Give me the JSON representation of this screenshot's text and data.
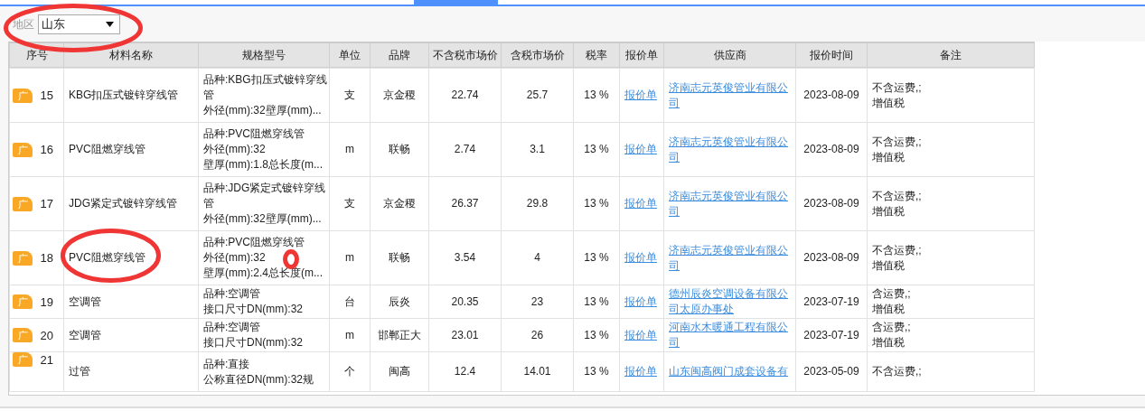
{
  "filter": {
    "label": "地区",
    "value": "山东"
  },
  "table": {
    "columns": [
      "序号",
      "材料名称",
      "规格型号",
      "单位",
      "品牌",
      "不含税市场价",
      "含税市场价",
      "税率",
      "报价单",
      "供应商",
      "报价时间",
      "备注"
    ],
    "rows": [
      {
        "badge": "广",
        "index": "15",
        "name": "KBG扣压式镀锌穿线管",
        "spec": [
          "品种:KBG扣压式镀锌穿线",
          "管",
          "外径(mm):32壁厚(mm)..."
        ],
        "unit": "支",
        "brand": "京金稷",
        "price": "22.74",
        "price_tax": "25.7",
        "tax_rate": "13 %",
        "quote": "报价单",
        "supplier": "济南志元英俊管业有限公司",
        "date": "2023-08-09",
        "remark": [
          "不含运费,;",
          "增值税"
        ]
      },
      {
        "badge": "广",
        "index": "16",
        "name": "PVC阻燃穿线管",
        "spec": [
          "品种:PVC阻燃穿线管",
          "外径(mm):32",
          "壁厚(mm):1.8总长度(m..."
        ],
        "unit": "m",
        "brand": "联畅",
        "price": "2.74",
        "price_tax": "3.1",
        "tax_rate": "13 %",
        "quote": "报价单",
        "supplier": "济南志元英俊管业有限公司",
        "date": "2023-08-09",
        "remark": [
          "不含运费,;",
          "增值税"
        ]
      },
      {
        "badge": "广",
        "index": "17",
        "name": "JDG紧定式镀锌穿线管",
        "spec": [
          "品种:JDG紧定式镀锌穿线",
          "管",
          "外径(mm):32壁厚(mm)..."
        ],
        "unit": "支",
        "brand": "京金稷",
        "price": "26.37",
        "price_tax": "29.8",
        "tax_rate": "13 %",
        "quote": "报价单",
        "supplier": "济南志元英俊管业有限公司",
        "date": "2023-08-09",
        "remark": [
          "不含运费,;",
          "增值税"
        ]
      },
      {
        "badge": "广",
        "index": "18",
        "name": "PVC阻燃穿线管",
        "spec": [
          "品种:PVC阻燃穿线管",
          "外径(mm):32",
          "壁厚(mm):2.4总长度(m..."
        ],
        "unit": "m",
        "brand": "联畅",
        "price": "3.54",
        "price_tax": "4",
        "tax_rate": "13 %",
        "quote": "报价单",
        "supplier": "济南志元英俊管业有限公司",
        "date": "2023-08-09",
        "remark": [
          "不含运费,;",
          "增值税"
        ]
      },
      {
        "badge": "广",
        "index": "19",
        "name": "空调管",
        "spec": [
          "品种:空调管",
          "接口尺寸DN(mm):32"
        ],
        "unit": "台",
        "brand": "辰炎",
        "price": "20.35",
        "price_tax": "23",
        "tax_rate": "13 %",
        "quote": "报价单",
        "supplier": "德州辰炎空调设备有限公司太原办事处",
        "date": "2023-07-19",
        "remark": [
          "含运费,;",
          "增值税"
        ]
      },
      {
        "badge": "广",
        "index": "20",
        "name": "空调管",
        "spec": [
          "品种:空调管",
          "接口尺寸DN(mm):32"
        ],
        "unit": "m",
        "brand": "邯郸正大",
        "price": "23.01",
        "price_tax": "26",
        "tax_rate": "13 %",
        "quote": "报价单",
        "supplier": "河南水木暖通工程有限公司",
        "date": "2023-07-19",
        "remark": [
          "含运费,;",
          "增值税"
        ]
      },
      {
        "badge": "广",
        "index": "21",
        "name": "过管",
        "spec": [
          "品种:直接",
          "公称直径DN(mm):32规"
        ],
        "unit": "个",
        "brand": "闽高",
        "price": "12.4",
        "price_tax": "14.01",
        "tax_rate": "13 %",
        "quote": "报价单",
        "supplier": "山东闽高阀门成套设备有",
        "date": "2023-05-09",
        "remark": [
          "不含运费,;"
        ]
      }
    ]
  }
}
